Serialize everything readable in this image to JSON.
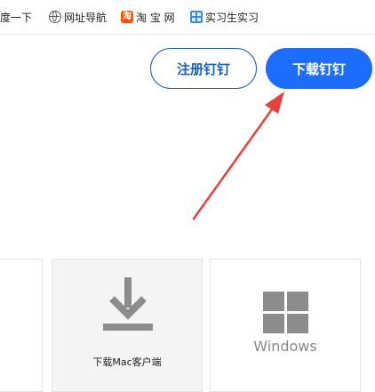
{
  "bookmarks": [
    {
      "label": "度一下",
      "icon": ""
    },
    {
      "label": "网址导航",
      "icon": "globe-icon"
    },
    {
      "label": "淘 宝 网",
      "icon": "taobao-icon",
      "glyph": "淘"
    },
    {
      "label": "实习生实习",
      "icon": "shixi-icon"
    }
  ],
  "buttons": {
    "register_label": "注册钉钉",
    "download_label": "下载钉钉"
  },
  "cards": {
    "mac_label": "下载Mac客户端",
    "windows_label": "Windows"
  },
  "colors": {
    "primary": "#1a6dff",
    "outline": "#1c5fb5",
    "annotation": "#e8403a",
    "icon_gray": "#8c8c8c"
  },
  "icons": {
    "download": "download-arrow-icon",
    "windows": "windows-logo-icon",
    "pointer": "annotation-arrow"
  }
}
